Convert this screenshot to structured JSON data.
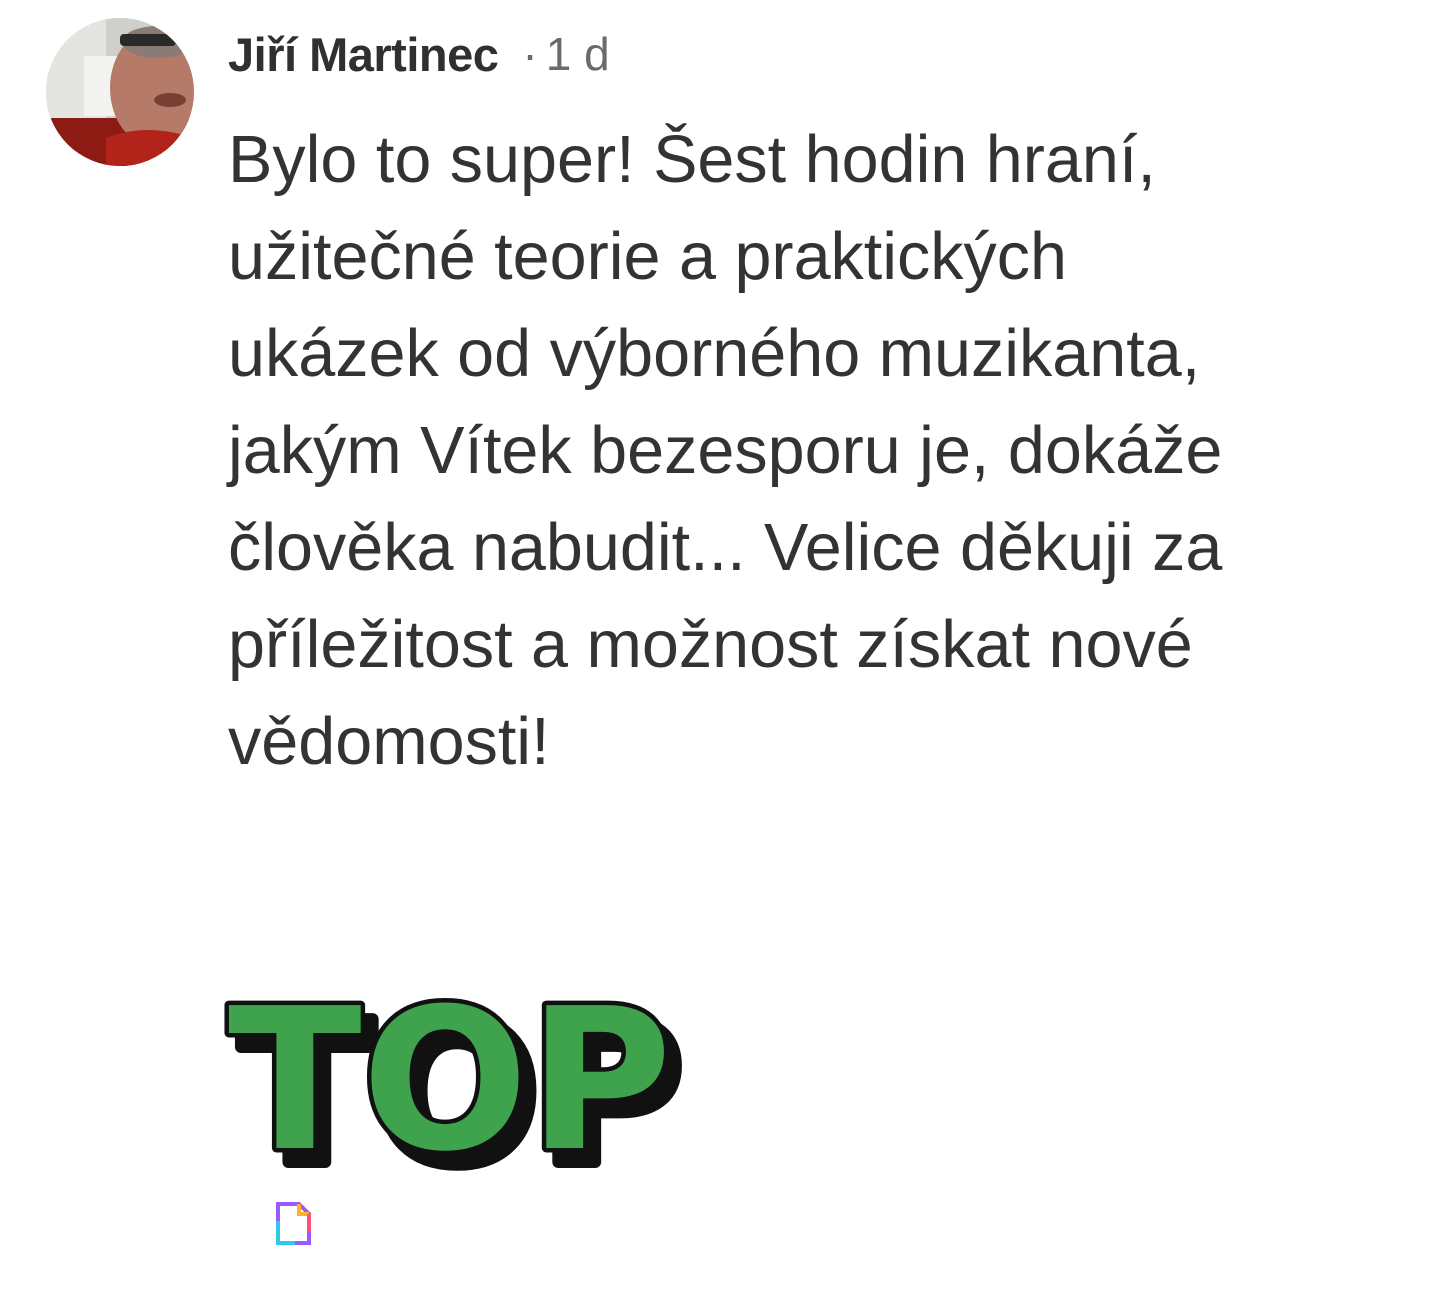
{
  "comment": {
    "author": "Jiří Martinec",
    "separator": "·",
    "time": "1 d",
    "avatar_icon": "user-avatar-photo",
    "text": "Bylo to super! Šest hodin hraní,\nužitečné teorie a praktických\nukázek od výborného muzikanta,\njakým Vítek bezesporu je, dokáže\nčlověka nabudit... Velice děkuji za\npříležitost a možnost získat nové\nvědomosti!",
    "sticker": {
      "text": "TOP",
      "fill_color": "#3fa34d",
      "shadow_color": "#111111"
    },
    "attachment_icon": "file-icon"
  }
}
